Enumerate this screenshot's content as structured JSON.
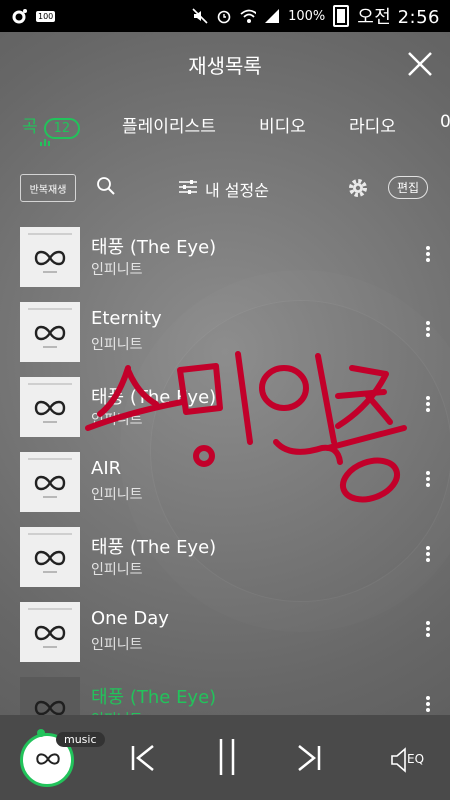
{
  "status_bar": {
    "battery_badge": "100",
    "battery_percent": "100%",
    "time": "오전 2:56"
  },
  "header": {
    "title": "재생목록"
  },
  "tabs": [
    {
      "label": "곡",
      "count": "12",
      "active": true
    },
    {
      "label": "플레이리스트"
    },
    {
      "label": "비디오"
    },
    {
      "label": "라디오"
    },
    {
      "label": "0"
    }
  ],
  "controls": {
    "repeat_label": "반복재생",
    "sort_label": "내 설정순",
    "edit_label": "편집"
  },
  "tracks": [
    {
      "title": "태풍 (The Eye)",
      "artist": "인피니트"
    },
    {
      "title": "Eternity",
      "artist": "인피니트"
    },
    {
      "title": "태풍 (The Eye)",
      "artist": "인피니트"
    },
    {
      "title": "AIR",
      "artist": "인피니트"
    },
    {
      "title": "태풍 (The Eye)",
      "artist": "인피니트"
    },
    {
      "title": "One Day",
      "artist": "인피니트"
    },
    {
      "title": "태풍 (The Eye)",
      "artist": "인피니트",
      "playing": true
    }
  ],
  "player": {
    "badge": "music",
    "eq_label": "EQ"
  },
  "colors": {
    "accent": "#22c35b",
    "sticker": "#c2002a"
  }
}
